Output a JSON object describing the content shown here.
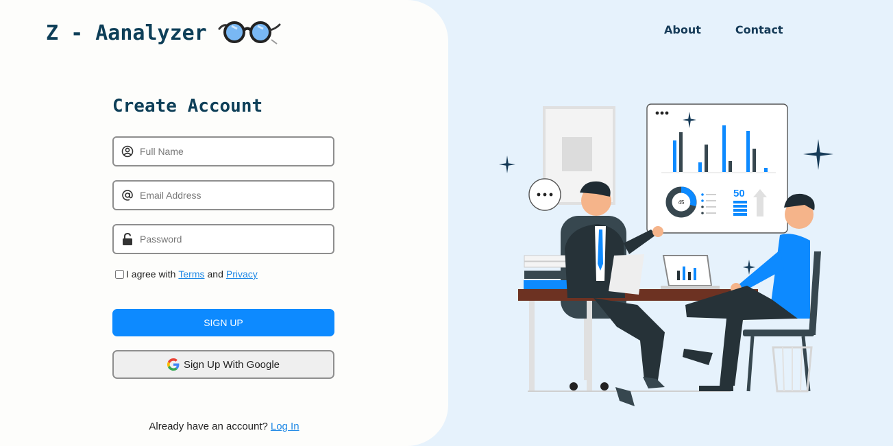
{
  "brand": {
    "name": "Z - Aanalyzer",
    "logo_icon": "glasses-icon"
  },
  "nav": {
    "about": "About",
    "contact": "Contact"
  },
  "form": {
    "title": "Create Account",
    "full_name_placeholder": "Full Name",
    "email_placeholder": "Email Address",
    "password_placeholder": "Password",
    "agree_prefix": "I agree with",
    "terms_label": "Terms",
    "and_label": "and",
    "privacy_label": "Privacy",
    "signup_label": "SIGN UP",
    "google_label": "Sign Up With Google",
    "login_prompt": "Already have an account?",
    "login_link": "Log In"
  },
  "illustration": {
    "donut_value": "45",
    "metric_value": "50"
  },
  "colors": {
    "accent": "#0d8aff",
    "brand": "#0e3f58",
    "link": "#1e88e5",
    "right_bg": "#e6f2fc"
  }
}
